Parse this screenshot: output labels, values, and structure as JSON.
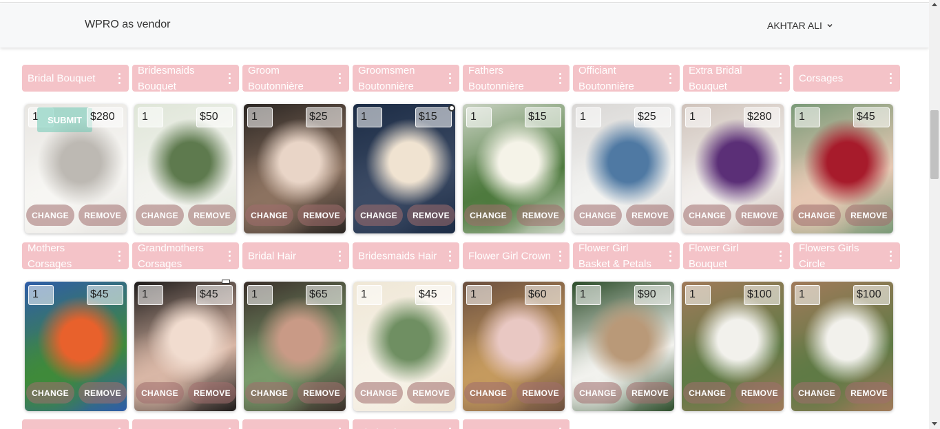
{
  "header": {
    "brand": "WPRO as vendor",
    "user_name": "AKHTAR ALI"
  },
  "categories_row1": [
    "Bridal Bouquet",
    "Bridesmaids Bouquet",
    "Groom Boutonnière",
    "Groomsmen Boutonnière",
    "Fathers Boutonnière",
    "Officiant Boutonnière",
    "Extra Bridal Bouquet",
    "Corsages"
  ],
  "categories_row2": [
    "Mothers Corsages",
    "Grandmothers Corsages",
    "Bridal Hair",
    "Bridesmaids Hair",
    "Flower Girl Crown",
    "Flower Girl Basket & Petals",
    "Flower Girl Bouquet",
    "Flowers Girls Circle"
  ],
  "categories_row3": [
    "",
    "",
    "",
    "Virgin of Mary",
    ""
  ],
  "cards_row1": [
    {
      "qty": "1",
      "price": "$280",
      "colors": [
        "#e8e6e2",
        "#bdb9b3",
        "#f7f6f3"
      ]
    },
    {
      "qty": "1",
      "price": "$50",
      "colors": [
        "#dfe6d8",
        "#5e7a4e",
        "#f3f3ef"
      ]
    },
    {
      "qty": "1",
      "price": "$25",
      "colors": [
        "#2b2623",
        "#e9d5c7",
        "#8c7260"
      ]
    },
    {
      "qty": "1",
      "price": "$15",
      "colors": [
        "#1c2c45",
        "#f0e3d1",
        "#3b4a64"
      ]
    },
    {
      "qty": "1",
      "price": "$15",
      "colors": [
        "#c9d2c2",
        "#f5f3e8",
        "#4e7a3e"
      ]
    },
    {
      "qty": "1",
      "price": "$25",
      "colors": [
        "#d9d7d5",
        "#4f79a3",
        "#f2f2f0"
      ]
    },
    {
      "qty": "1",
      "price": "$280",
      "colors": [
        "#cfc3bb",
        "#5b2f77",
        "#f2efec"
      ]
    },
    {
      "qty": "1",
      "price": "$45",
      "colors": [
        "#7a9a78",
        "#a71b2b",
        "#e7c9b4"
      ]
    }
  ],
  "cards_row2": [
    {
      "qty": "1",
      "price": "$45",
      "colors": [
        "#2f5da8",
        "#e8612c",
        "#3f8a3a"
      ]
    },
    {
      "qty": "1",
      "price": "$45",
      "colors": [
        "#1f1c1b",
        "#f1dccf",
        "#d9b7a6"
      ]
    },
    {
      "qty": "1",
      "price": "$65",
      "colors": [
        "#3a2f2a",
        "#c99a86",
        "#7a9a6b"
      ]
    },
    {
      "qty": "1",
      "price": "$45",
      "colors": [
        "#efe7d6",
        "#6f8f62",
        "#f7f2e8"
      ]
    },
    {
      "qty": "1",
      "price": "$60",
      "colors": [
        "#6b4f3f",
        "#e9c8c3",
        "#c59a5e"
      ]
    },
    {
      "qty": "1",
      "price": "$90",
      "colors": [
        "#2d4d2b",
        "#b99978",
        "#f2f2ee"
      ]
    },
    {
      "qty": "1",
      "price": "$100",
      "colors": [
        "#a07a5a",
        "#f2f1ec",
        "#5f7a45"
      ]
    },
    {
      "qty": "1",
      "price": "$100",
      "colors": [
        "#a07a5a",
        "#f2f1ec",
        "#5f7a45"
      ]
    }
  ],
  "card_buttons": {
    "change": "CHANGE",
    "remove": "REMOVE"
  },
  "submit_label": "SUBMIT"
}
